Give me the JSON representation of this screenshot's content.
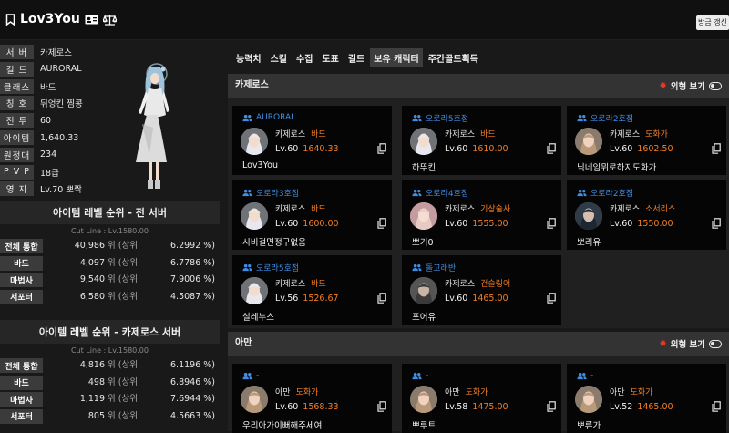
{
  "header": {
    "title": "Lov3You",
    "refresh_label": "방금 갱신"
  },
  "profile": {
    "rows": [
      {
        "label": "서 버",
        "value": "카제로스"
      },
      {
        "label": "길 드",
        "value": "AURORAL"
      },
      {
        "label": "클래스",
        "value": "바드"
      },
      {
        "label": "칭 호",
        "value": "뒤엉킨 찜콩"
      },
      {
        "label": "전 투",
        "value": "60"
      },
      {
        "label": "아이템",
        "value": "1,640.33"
      },
      {
        "label": "원정대",
        "value": "234"
      },
      {
        "label": "P V P",
        "value": "18급"
      },
      {
        "label": "영 지",
        "value": "Lv.70 뽀짝"
      }
    ]
  },
  "rank_all": {
    "title": "아이템 레벨 순위 - 전 서버",
    "cutline": "Cut Line : Lv.1580.00",
    "rows": [
      {
        "label": "전체 통합",
        "rank": "40,986",
        "unit": "위 (상위",
        "pct": "6.2992 %)"
      },
      {
        "label": "바드",
        "rank": "4,097",
        "unit": "위 (상위",
        "pct": "6.7786 %)"
      },
      {
        "label": "마법사",
        "rank": "9,540",
        "unit": "위 (상위",
        "pct": "7.9006 %)"
      },
      {
        "label": "서포터",
        "rank": "6,580",
        "unit": "위 (상위",
        "pct": "4.5087 %)"
      }
    ]
  },
  "rank_server": {
    "title": "아이템 레벨 순위 - 카제로스 서버",
    "cutline": "Cut Line : Lv.1580.00",
    "rows": [
      {
        "label": "전체 통합",
        "rank": "4,816",
        "unit": "위 (상위",
        "pct": "6.1196 %)"
      },
      {
        "label": "바드",
        "rank": "498",
        "unit": "위 (상위",
        "pct": "6.8946 %)"
      },
      {
        "label": "마법사",
        "rank": "1,119",
        "unit": "위 (상위",
        "pct": "7.6944 %)"
      },
      {
        "label": "서포터",
        "rank": "805",
        "unit": "위 (상위",
        "pct": "4.5663 %)"
      }
    ]
  },
  "tabs": [
    "능력치",
    "스킬",
    "수집",
    "도표",
    "길드",
    "보유 캐릭터",
    "주간골드획득"
  ],
  "active_tab": "보유 캐릭터",
  "appearance_label": "외형 보기",
  "servers": [
    {
      "name": "카제로스",
      "characters": [
        {
          "guild": "AURORAL",
          "server": "카제로스",
          "class": "바드",
          "level": "Lv.60",
          "item_level": "1640.33",
          "name": "Lov3You",
          "portrait": "white"
        },
        {
          "guild": "오로라5호점",
          "server": "카제로스",
          "class": "바드",
          "level": "Lv.60",
          "item_level": "1610.00",
          "name": "하뚜킨",
          "portrait": "white"
        },
        {
          "guild": "오로라2호점",
          "server": "카제로스",
          "class": "도화가",
          "level": "Lv.60",
          "item_level": "1602.50",
          "name": "닉네임뮈로하지도화가",
          "portrait": "tan"
        },
        {
          "guild": "오로라3호점",
          "server": "카제로스",
          "class": "바드",
          "level": "Lv.60",
          "item_level": "1600.00",
          "name": "시비걸면정구없음",
          "portrait": "white"
        },
        {
          "guild": "오로라4호점",
          "server": "카제로스",
          "class": "기상술사",
          "level": "Lv.60",
          "item_level": "1555.00",
          "name": "뽀기0",
          "portrait": "pink"
        },
        {
          "guild": "오로라2호점",
          "server": "카제로스",
          "class": "소서리스",
          "level": "Lv.60",
          "item_level": "1550.00",
          "name": "뽀리유",
          "portrait": "dark"
        },
        {
          "guild": "오로라5호점",
          "server": "카제로스",
          "class": "바드",
          "level": "Lv.56",
          "item_level": "1526.67",
          "name": "실레누스",
          "portrait": "white"
        },
        {
          "guild": "돌고래반",
          "server": "카제로스",
          "class": "건슬링어",
          "level": "Lv.60",
          "item_level": "1465.00",
          "name": "포어유",
          "portrait": "gray"
        }
      ]
    },
    {
      "name": "아만",
      "characters": [
        {
          "guild": "-",
          "server": "아만",
          "class": "도화가",
          "level": "Lv.60",
          "item_level": "1568.33",
          "name": "우리아가이뻐해주세여",
          "portrait": "tan"
        },
        {
          "guild": "-",
          "server": "아만",
          "class": "도화가",
          "level": "Lv.58",
          "item_level": "1475.00",
          "name": "뽀루트",
          "portrait": "tan"
        },
        {
          "guild": "-",
          "server": "아만",
          "class": "도화가",
          "level": "Lv.52",
          "item_level": "1465.00",
          "name": "뽀류가",
          "portrait": "tan"
        }
      ]
    }
  ],
  "colors": {
    "accent_orange": "#f47f24",
    "guild_blue": "#3f8ee5",
    "appearance_dot": "#e5392a"
  }
}
